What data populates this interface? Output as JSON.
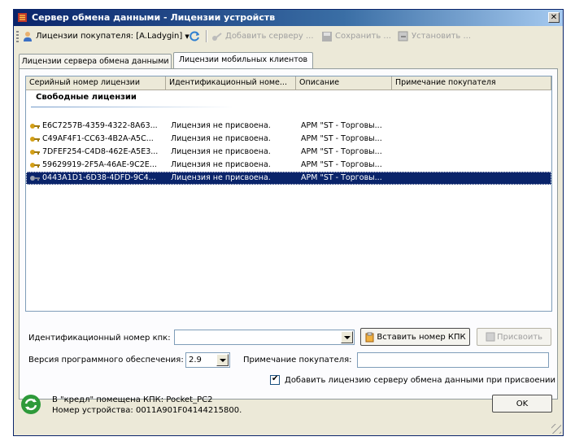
{
  "window": {
    "title": "Сервер обмена данными - Лицензии устройств",
    "close_glyph": "✕"
  },
  "toolbar": {
    "customer_label": "Лицензии покупателя: [A.Ladygin]",
    "add_label": "Добавить серверу ...",
    "save_label": "Сохранить ...",
    "install_label": "Установить ..."
  },
  "tabs": [
    {
      "label": "Лицензии сервера обмена данными",
      "active": false
    },
    {
      "label": "Лицензии мобильных клиентов",
      "active": true
    }
  ],
  "list": {
    "columns": [
      "Серийный номер лицензии",
      "Идентификационный номе...",
      "Описание",
      "Примечание покупателя"
    ],
    "group_title": "Свободные лицензии",
    "rows": [
      {
        "serial": "E6C7257B-4359-4322-8A63...",
        "id": "Лицензия не присвоена.",
        "desc": "АРМ \"ST - Торговы...",
        "note": ""
      },
      {
        "serial": "C49AF4F1-CC63-4B2A-A5C...",
        "id": "Лицензия не присвоена.",
        "desc": "АРМ \"ST - Торговы...",
        "note": ""
      },
      {
        "serial": "7DFEF254-C4D8-462E-A5E3...",
        "id": "Лицензия не присвоена.",
        "desc": "АРМ \"ST - Торговы...",
        "note": ""
      },
      {
        "serial": "59629919-2F5A-46AE-9C2E...",
        "id": "Лицензия не присвоена.",
        "desc": "АРМ \"ST - Торговы...",
        "note": ""
      },
      {
        "serial": "0443A1D1-6D38-4DFD-9C4...",
        "id": "Лицензия не присвоена.",
        "desc": "АРМ \"ST - Торговы...",
        "note": "",
        "selected": true
      }
    ]
  },
  "form": {
    "kpk_id_label": "Идентификационный номер кпк:",
    "kpk_id_value": "",
    "insert_kpk_button": "Вставить номер КПК",
    "assign_button": "Присвоить",
    "version_label": "Версия программного обеспечения:",
    "version_value": "2.9",
    "customer_note_label": "Примечание покупателя:",
    "customer_note_value": "",
    "add_license_checkbox_label": "Добавить лицензию серверу обмена данными при присвоении",
    "add_license_checked": true
  },
  "status": {
    "line1": "В \"кредл\" помещена КПК: Pocket_PC2",
    "line2": "Номер устройства: 0011A901F04144215800."
  },
  "ok_button": "OK",
  "colors": {
    "selection": "#0a246a",
    "title_start": "#0a246a",
    "title_end": "#a6caf0"
  }
}
